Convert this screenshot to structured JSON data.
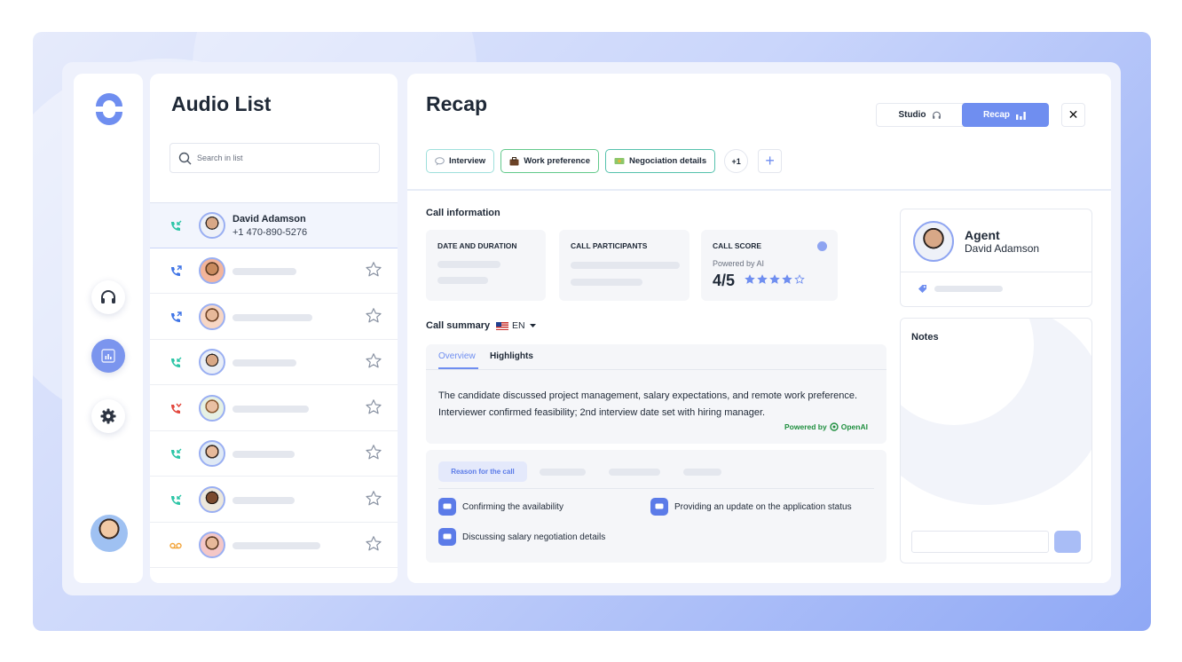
{
  "sidebar": {
    "nav": [
      "headphones-icon",
      "chart-icon",
      "gear-icon"
    ],
    "active_nav": "chart-icon"
  },
  "audio_list": {
    "title": "Audio List",
    "search_placeholder": "Search in list",
    "selected": {
      "name": "David Adamson",
      "phone": "+1 470-890-5276",
      "call_type": "incoming"
    },
    "rows": [
      {
        "call_type": "outgoing",
        "call_color": "#3f74e6",
        "starred": false
      },
      {
        "call_type": "outgoing",
        "call_color": "#3f74e6",
        "starred": false
      },
      {
        "call_type": "incoming",
        "call_color": "#2cc5a6",
        "starred": false
      },
      {
        "call_type": "missed",
        "call_color": "#e2463c",
        "starred": false
      },
      {
        "call_type": "incoming",
        "call_color": "#2cc5a6",
        "starred": false
      },
      {
        "call_type": "incoming",
        "call_color": "#2cc5a6",
        "starred": false
      },
      {
        "call_type": "voicemail",
        "call_color": "#f2a43a",
        "starred": false
      }
    ]
  },
  "recap": {
    "title": "Recap",
    "mode_studio": "Studio",
    "mode_recap": "Recap",
    "tags": [
      {
        "label": "Interview",
        "icon": "speech-bubble-icon"
      },
      {
        "label": "Work preference",
        "icon": "briefcase-icon"
      },
      {
        "label": "Negociation details",
        "icon": "money-icon"
      }
    ],
    "more_tags": "+1",
    "call_information": {
      "heading": "Call information",
      "date_duration": "DATE AND DURATION",
      "participants": "CALL PARTICIPANTS",
      "score_heading": "CALL SCORE",
      "score_sub": "Powered by AI",
      "score_value": "4/5",
      "score": 4,
      "score_max": 5
    },
    "summary": {
      "heading": "Call summary",
      "language": "EN",
      "tab_overview": "Overview",
      "tab_highlights": "Highlights",
      "text": "The candidate discussed project management, salary expectations, and remote work preference. Interviewer confirmed feasibility; 2nd interview date set with hiring manager.",
      "powered_by": "Powered by",
      "provider": "OpenAI"
    },
    "reasons": {
      "tab": "Reason for the call",
      "items": [
        "Confirming the availability",
        "Providing an update on the application status",
        "Discussing salary negotiation details"
      ]
    },
    "agent": {
      "role": "Agent",
      "name": "David Adamson"
    },
    "notes": {
      "title": "Notes"
    }
  },
  "colors": {
    "accent": "#6f8ef0",
    "incoming": "#2cc5a6",
    "outgoing": "#3f74e6",
    "missed": "#e2463c",
    "voicemail": "#f2a43a",
    "openai": "#1f8f3f"
  }
}
